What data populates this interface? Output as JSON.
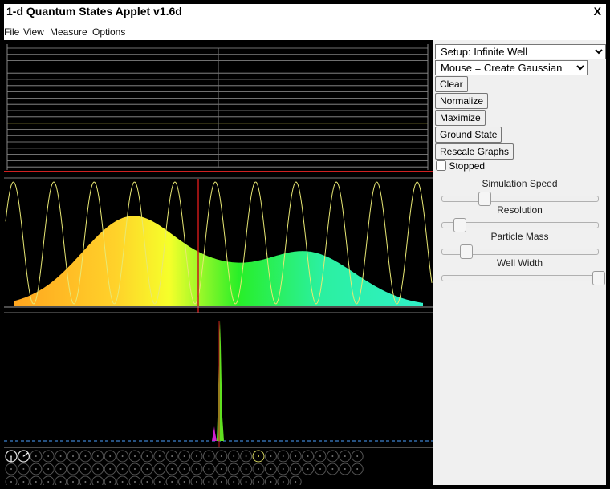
{
  "window": {
    "title": "1-d Quantum States Applet v1.6d",
    "close_label": "X"
  },
  "menu": [
    {
      "label": "File"
    },
    {
      "label": "View"
    },
    {
      "label": "Measure"
    },
    {
      "label": "Options"
    }
  ],
  "controls": {
    "setup": {
      "selected": "Setup: Infinite Well"
    },
    "mouse": {
      "selected": "Mouse = Create Gaussian"
    },
    "buttons": {
      "clear": "Clear",
      "normalize": "Normalize",
      "maximize": "Maximize",
      "ground_state": "Ground State",
      "rescale_graphs": "Rescale Graphs"
    },
    "stopped": {
      "label": "Stopped",
      "checked": false
    },
    "sliders": [
      {
        "label": "Simulation Speed",
        "value": 0.27
      },
      {
        "label": "Resolution",
        "value": 0.11
      },
      {
        "label": "Particle Mass",
        "value": 0.15
      },
      {
        "label": "Well Width",
        "value": 1.0
      }
    ]
  },
  "colors": {
    "level_line": "#c8c8c8",
    "occupied_level": "#b8b24a",
    "potential": "#e02020",
    "wave_real": "#e8e874",
    "momentum_top": "#e8ff60",
    "momentum_bottom": "#00c040",
    "momentum_side": "#d020d0",
    "baseline": "#4aa0ff"
  }
}
